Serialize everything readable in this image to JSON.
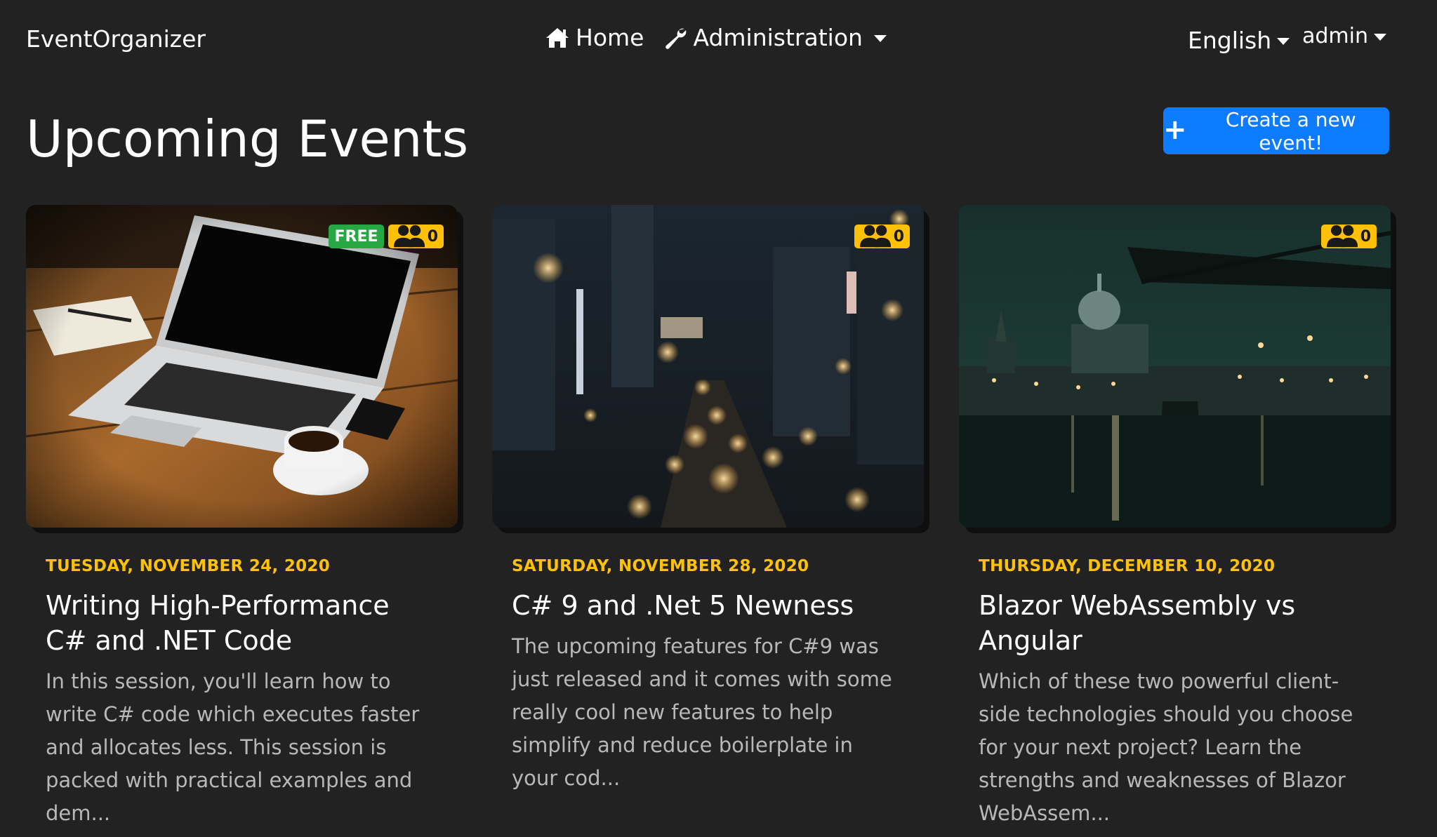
{
  "nav": {
    "brand": "EventOrganizer",
    "home_label": "Home",
    "admin_label": "Administration",
    "language_label": "English",
    "user_label": "admin"
  },
  "page": {
    "title": "Upcoming Events",
    "create_button_label": "Create a new event!"
  },
  "events": [
    {
      "date": "TUESDAY, NOVEMBER 24, 2020",
      "title": "Writing High-Performance C# and .NET Code",
      "description": "In this session, you'll learn how to write C# code which executes faster and allocates less. This session is packed with practical examples and dem...",
      "free_badge": "FREE",
      "attendees": "0"
    },
    {
      "date": "SATURDAY, NOVEMBER 28, 2020",
      "title": "C# 9 and .Net 5 Newness",
      "description": "The upcoming features for C#9 was just released and it comes with some really cool new features to help simplify and reduce boilerplate in your cod...",
      "attendees": "0"
    },
    {
      "date": "THURSDAY, DECEMBER 10, 2020",
      "title": "Blazor WebAssembly vs Angular",
      "description": "Which of these two powerful client-side technologies should you choose for your next project? Learn the strengths and weaknesses of Blazor WebAssem...",
      "attendees": "0"
    }
  ],
  "colors": {
    "background": "#222222",
    "accent_blue": "#0d7bff",
    "date_yellow": "#ffc107",
    "free_green": "#28a745"
  },
  "icons": {
    "home": "home-icon",
    "admin": "wrench-icon",
    "create": "plus-icon",
    "attendees": "users-icon"
  }
}
